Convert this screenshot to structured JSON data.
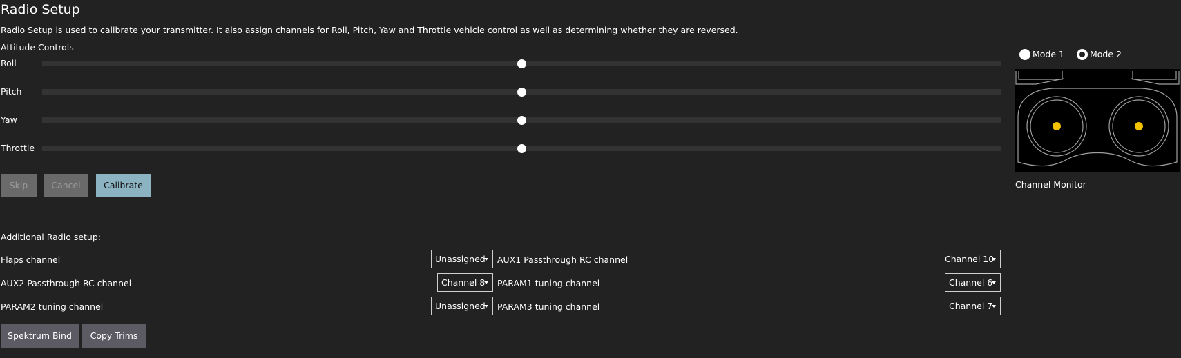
{
  "header": {
    "title": "Radio Setup",
    "description": "Radio Setup is used to calibrate your transmitter. It also assign channels for Roll, Pitch, Yaw and Throttle vehicle control as well as determining whether they are reversed."
  },
  "attitude": {
    "label": "Attitude Controls",
    "sliders": [
      {
        "label": "Roll",
        "value_fraction": 0.5
      },
      {
        "label": "Pitch",
        "value_fraction": 0.5
      },
      {
        "label": "Yaw",
        "value_fraction": 0.5
      },
      {
        "label": "Throttle",
        "value_fraction": 0.5
      }
    ]
  },
  "buttons": {
    "skip": "Skip",
    "cancel": "Cancel",
    "calibrate": "Calibrate",
    "spektrum_bind": "Spektrum Bind",
    "copy_trims": "Copy Trims"
  },
  "mode": {
    "mode1": "Mode 1",
    "mode2": "Mode 2",
    "selected": "Mode 2"
  },
  "channel_monitor": {
    "label": "Channel Monitor"
  },
  "additional": {
    "label": "Additional Radio setup:",
    "rows": [
      {
        "left_label": "Flaps channel",
        "left_value": "Unassigned",
        "right_label": "AUX1 Passthrough RC channel",
        "right_value": "Channel 10"
      },
      {
        "left_label": "AUX2 Passthrough RC channel",
        "left_value": "Channel 8",
        "right_label": "PARAM1 tuning channel",
        "right_value": "Channel 6"
      },
      {
        "left_label": "PARAM2 tuning channel",
        "left_value": "Unassigned",
        "right_label": "PARAM3 tuning channel",
        "right_value": "Channel 7"
      }
    ]
  },
  "colors": {
    "background": "#222222",
    "primary_button": "#8cb3c1",
    "stick_dot": "#f2c200"
  }
}
